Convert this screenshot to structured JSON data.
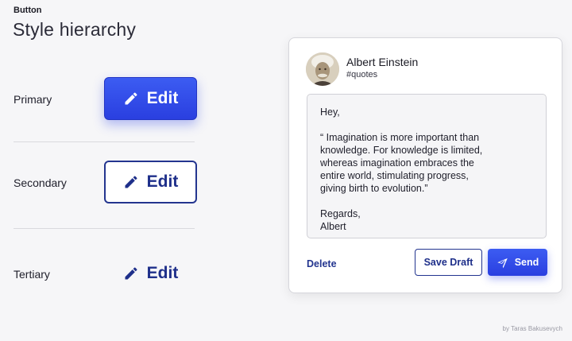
{
  "header": {
    "eyebrow": "Button",
    "title": "Style hierarchy"
  },
  "rows": [
    {
      "label": "Primary",
      "button_label": "Edit",
      "style": "primary"
    },
    {
      "label": "Secondary",
      "button_label": "Edit",
      "style": "secondary"
    },
    {
      "label": "Tertiary",
      "button_label": "Edit",
      "style": "tertiary"
    }
  ],
  "icons": {
    "edit": "pencil-icon",
    "send": "paper-plane-icon",
    "avatar": "portrait-avatar"
  },
  "colors": {
    "primary": "#2f48e8",
    "secondary_border": "#23358f",
    "text_dark": "#1e1e2a",
    "background": "#f6f6f8"
  },
  "card": {
    "author_name": "Albert Einstein",
    "author_tag": "#quotes",
    "message": {
      "greeting": "Hey,",
      "quote_lines": [
        "“ Imagination is more important than",
        "knowledge. For knowledge is limited,",
        "whereas imagination embraces the",
        "entire world, stimulating progress,",
        "giving birth to evolution.”"
      ],
      "signoff": "Regards,",
      "signature": "Albert"
    },
    "delete_label": "Delete",
    "save_draft_label": "Save Draft",
    "send_label": "Send"
  },
  "credit": "by Taras Bakusevych"
}
